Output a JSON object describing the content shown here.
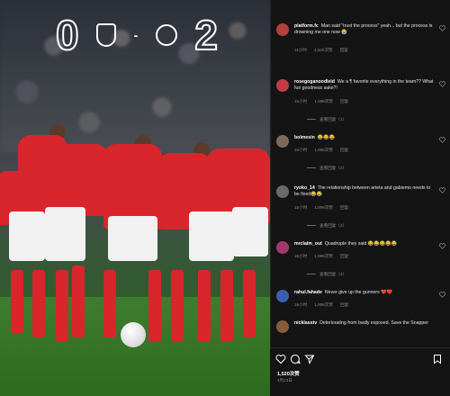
{
  "scoreboard": {
    "home_score": "0",
    "separator": "-",
    "away_score": "2"
  },
  "comments": [
    {
      "username": "platform.fc",
      "text": "Man said \"trust the process\" yeah... but the process is drowning me one now 😭",
      "meta": [
        "11小时",
        "4,520次赞",
        "回复"
      ],
      "replies": "",
      "avatar_color": "#b0423b"
    },
    {
      "username": "rosegoganoodleld",
      "text": "We a ¶ favorite everything in the team?? What fun goodness sake?!",
      "meta": [
        "15小时",
        "1,998次赞",
        "回复"
      ],
      "replies": "查看回复（1）",
      "avatar_color": "#c23b45"
    },
    {
      "username": "bolmesin",
      "text": "😂😂😂",
      "meta": [
        "15小时",
        "1,998次赞",
        "回复"
      ],
      "replies": "查看回复（2）",
      "avatar_color": "#7a6a5a"
    },
    {
      "username": "ryoko_14",
      "text": "The relationship between arteta and gabiemo needs to be fixed😂😂",
      "meta": [
        "15小时",
        "1,998次赞",
        "回复"
      ],
      "replies": "查看回复（2）",
      "avatar_color": "#6a6a6a"
    },
    {
      "username": "mrclaim_out",
      "text": "Quadruple they said 😂😂😂😂😂",
      "meta": [
        "15小时",
        "1,998次赞",
        "回复"
      ],
      "replies": "查看回复（4）",
      "avatar_color": "#a03a6a"
    },
    {
      "username": "rahul.fahade",
      "text": "Never give up the gunners ❤️❤️",
      "meta": [
        "15小时",
        "1,998次赞",
        "回复"
      ],
      "replies": "",
      "avatar_color": "#3b5fb0"
    },
    {
      "username": "nicklasstv",
      "text": "Deteriorating from badly exposed. Save the Snapper",
      "meta": [
        "",
        "",
        ""
      ],
      "replies": "",
      "avatar_color": "#8a5a3a"
    }
  ],
  "actions": {
    "likes": "1,520次赞",
    "date": "4月23日"
  }
}
